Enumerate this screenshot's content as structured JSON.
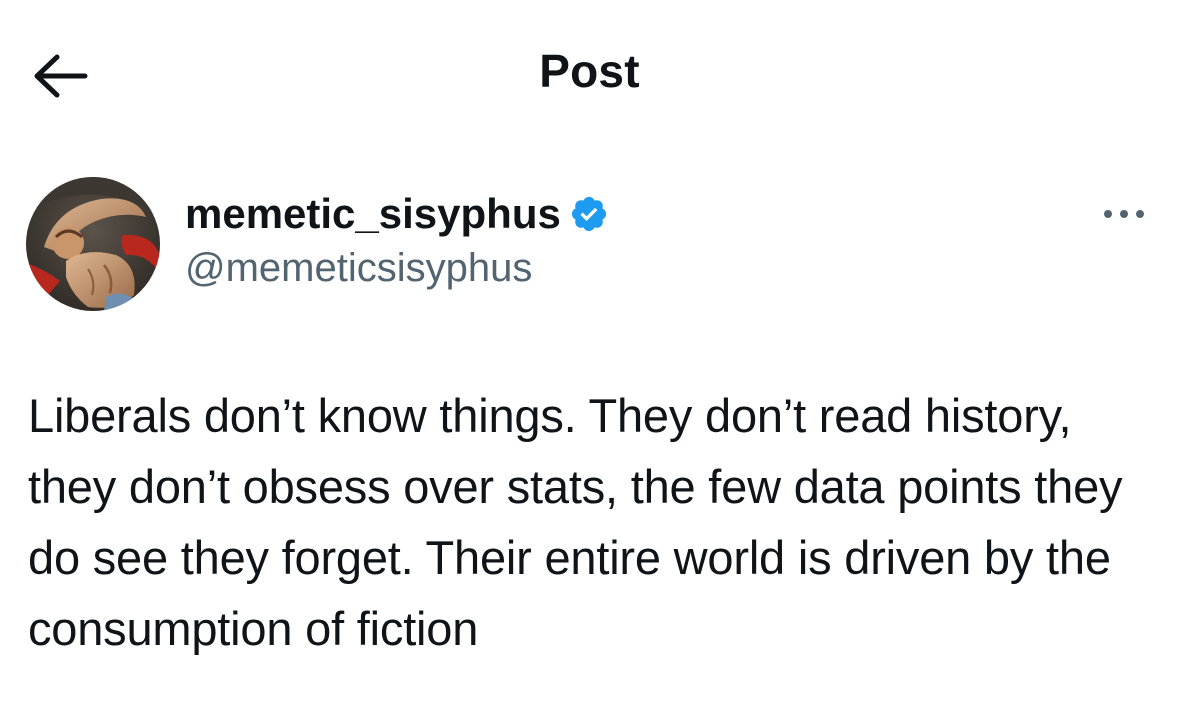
{
  "header": {
    "title": "Post",
    "back_icon": "arrow-left-icon"
  },
  "author": {
    "display_name": "memetic_sisyphus",
    "handle": "@memeticsisyphus",
    "verified_icon": "verified-badge-icon",
    "avatar": "classical-painting-avatar"
  },
  "menu": {
    "more_icon": "more-dots-icon"
  },
  "post": {
    "text": "Liberals don’t know things. They don’t read history, they don’t obsess over stats, the few data points they do see they forget. Their entire world is driven by the consumption of fiction"
  },
  "colors": {
    "text_primary": "#0f1419",
    "text_secondary": "#536471",
    "verified_blue": "#1d9bf0",
    "background": "#ffffff"
  }
}
